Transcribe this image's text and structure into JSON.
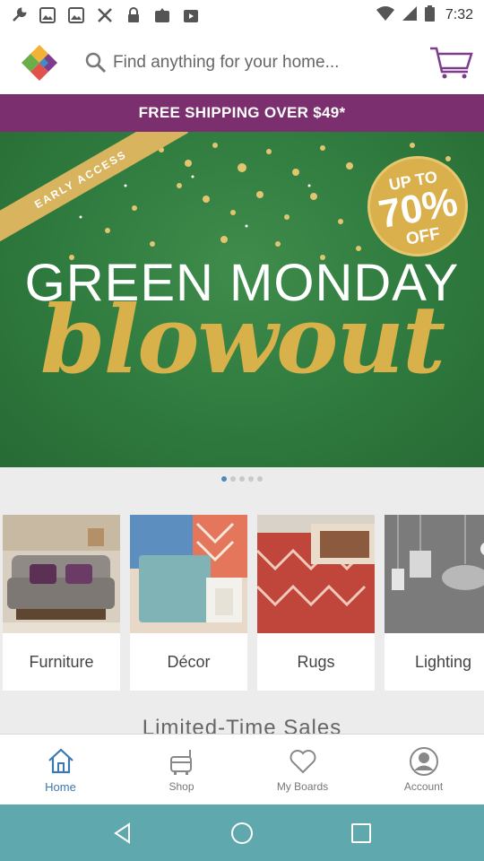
{
  "status_bar": {
    "time": "7:32",
    "icons": [
      "wrench-icon",
      "image-icon",
      "image-icon",
      "tools-icon",
      "lock-icon",
      "photo-upload-icon",
      "play-store-icon"
    ]
  },
  "header": {
    "search_placeholder": "Find anything for your home..."
  },
  "promo": {
    "text": "FREE SHIPPING OVER $49*"
  },
  "hero": {
    "ribbon": "EARLY ACCESS",
    "badge_line1": "UP TO",
    "badge_line2": "70%",
    "badge_line3": "OFF",
    "title": "GREEN MONDAY",
    "script": "blowout",
    "slide_count": 5,
    "active_slide": 0
  },
  "categories": [
    {
      "label": "Furniture"
    },
    {
      "label": "Décor"
    },
    {
      "label": "Rugs"
    },
    {
      "label": "Lighting"
    }
  ],
  "section_heading": "Limited-Time Sales",
  "bottom_nav": [
    {
      "label": "Home",
      "icon": "home-icon",
      "active": true
    },
    {
      "label": "Shop",
      "icon": "shop-icon",
      "active": false
    },
    {
      "label": "My Boards",
      "icon": "heart-icon",
      "active": false
    },
    {
      "label": "Account",
      "icon": "account-icon",
      "active": false
    }
  ],
  "colors": {
    "promo_bg": "#7b2f6e",
    "hero_green": "#2f7a3e",
    "gold": "#d9b04c",
    "active_nav": "#3c79b0",
    "system_nav": "#5fa9ae"
  }
}
